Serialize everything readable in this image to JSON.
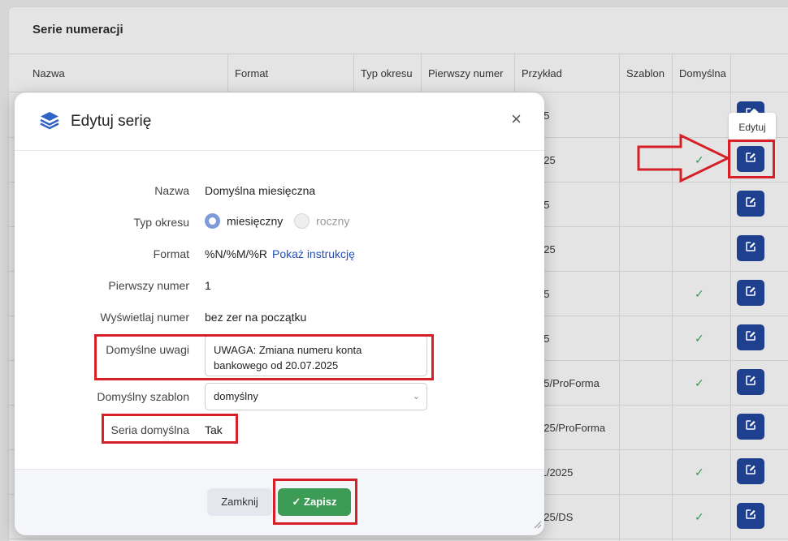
{
  "page": {
    "title": "Serie numeracji",
    "columns": [
      "Nazwa",
      "Format",
      "Typ okresu",
      "Pierwszy numer",
      "Przykład",
      "Szablon",
      "Domyślna"
    ],
    "rows": [
      {
        "example": "25",
        "default": false
      },
      {
        "example": "025",
        "default": true
      },
      {
        "example": "25",
        "default": false
      },
      {
        "example": "025",
        "default": false
      },
      {
        "example": "25",
        "default": true
      },
      {
        "example": "25",
        "default": true
      },
      {
        "example": "25/ProForma",
        "default": true
      },
      {
        "example": "025/ProForma",
        "default": false
      },
      {
        "example": "/1/2025",
        "default": true
      },
      {
        "example": "025/DS",
        "default": true
      }
    ],
    "check_symbol": "✓",
    "tooltip": "Edytuj"
  },
  "modal": {
    "title": "Edytuj serię",
    "close_symbol": "×",
    "fields": {
      "name_label": "Nazwa",
      "name_value": "Domyślna miesięczna",
      "period_label": "Typ okresu",
      "period_option_1": "miesięczny",
      "period_option_2": "roczny",
      "format_label": "Format",
      "format_value": "%N/%M/%R",
      "format_link": "Pokaż instrukcję",
      "first_label": "Pierwszy numer",
      "first_value": "1",
      "display_label": "Wyświetlaj numer",
      "display_value": "bez zer na początku",
      "notes_label": "Domyślne uwagi",
      "notes_value": "UWAGA: Zmiana numeru konta bankowego od 20.07.2025",
      "template_label": "Domyślny szablon",
      "template_value": "domyślny",
      "default_label": "Seria domyślna",
      "default_value": "Tak"
    },
    "buttons": {
      "close": "Zamknij",
      "save": "Zapisz"
    }
  },
  "colors": {
    "accent": "#1f3f8f",
    "save": "#3c9b55",
    "annotation": "#d61f26"
  }
}
